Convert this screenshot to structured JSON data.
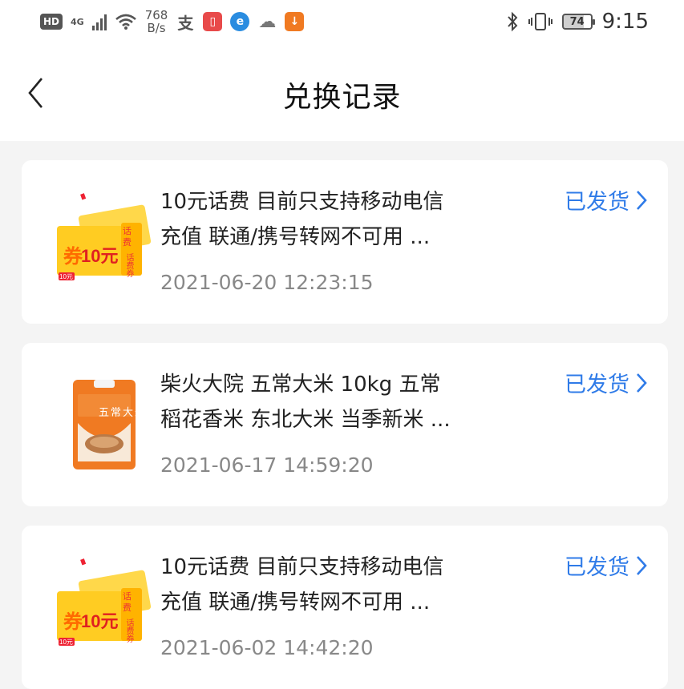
{
  "status_bar": {
    "hd": "HD",
    "network": "4G",
    "speed_value": "768",
    "speed_unit": "B/s",
    "battery": "74",
    "time": "9:15"
  },
  "nav": {
    "title": "兑换记录"
  },
  "records": [
    {
      "title_line1": "10元话费 目前只支持移动电信",
      "title_line2": "充值 联通/携号转网不可用 ...",
      "date": "2021-06-20 12:23:15",
      "status": "已发货",
      "thumb": "phone-credit-coupon",
      "coupon_amount": "10元",
      "coupon_side": "话费券",
      "coupon_tag": "10元"
    },
    {
      "title_line1": "柴火大院 五常大米 10kg 五常",
      "title_line2": "稻花香米 东北大米 当季新米 ...",
      "date": "2021-06-17 14:59:20",
      "status": "已发货",
      "thumb": "rice-bag",
      "rice_label": "五常大米"
    },
    {
      "title_line1": "10元话费 目前只支持移动电信",
      "title_line2": "充值 联通/携号转网不可用 ...",
      "date": "2021-06-02 14:42:20",
      "status": "已发货",
      "thumb": "phone-credit-coupon",
      "coupon_amount": "10元",
      "coupon_side": "话费券",
      "coupon_tag": "10元"
    }
  ],
  "colors": {
    "accent": "#2f7be8",
    "background": "#f4f4f4",
    "card": "#ffffff",
    "date_text": "#888888"
  }
}
